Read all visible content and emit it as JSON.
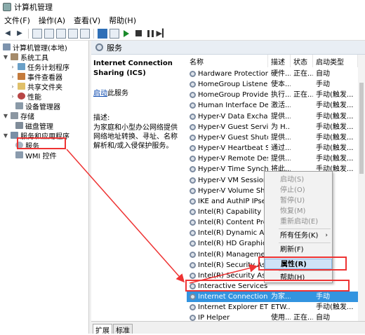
{
  "window": {
    "title": "计算机管理"
  },
  "menubar": {
    "items": [
      "文件(F)",
      "操作(A)",
      "查看(V)",
      "帮助(H)"
    ]
  },
  "tree": {
    "root": "计算机管理(本地)",
    "system_tools": "系统工具",
    "task_scheduler": "任务计划程序",
    "event_viewer": "事件查看器",
    "shared_folders": "共享文件夹",
    "performance": "性能",
    "device_manager": "设备管理器",
    "storage": "存储",
    "disk_management": "磁盘管理",
    "services_apps": "服务和应用程序",
    "services": "服务",
    "wmi": "WMI 控件"
  },
  "pane": {
    "title": "服务"
  },
  "description": {
    "service_name": "Internet Connection Sharing (ICS)",
    "start_link": "启动",
    "start_suffix": "此服务",
    "desc_label": "描述:",
    "desc_text": "为家庭和小型办公网络提供网络地址转换、寻址、名称解析和/或入侵保护服务。"
  },
  "columns": {
    "name": "名称",
    "desc": "描述",
    "status": "状态",
    "startup": "启动类型"
  },
  "services": [
    {
      "name": "Hardware Protection Ser...",
      "desc": "硬件...",
      "status": "正在...",
      "startup": "自动"
    },
    {
      "name": "HomeGroup Listener",
      "desc": "使本...",
      "status": "",
      "startup": "手动"
    },
    {
      "name": "HomeGroup Provider",
      "desc": "执行...",
      "status": "正在...",
      "startup": "手动(触发..."
    },
    {
      "name": "Human Interface Device ...",
      "desc": "激活...",
      "status": "",
      "startup": "手动(触发..."
    },
    {
      "name": "Hyper-V Data Exchange ...",
      "desc": "提供...",
      "status": "",
      "startup": "手动(触发..."
    },
    {
      "name": "Hyper-V Guest Service In...",
      "desc": "为 H...",
      "status": "",
      "startup": "手动(触发..."
    },
    {
      "name": "Hyper-V Guest Shutdown...",
      "desc": "提供...",
      "status": "",
      "startup": "手动(触发..."
    },
    {
      "name": "Hyper-V Heartbeat Service",
      "desc": "通过...",
      "status": "",
      "startup": "手动(触发..."
    },
    {
      "name": "Hyper-V Remote Deskto...",
      "desc": "提供...",
      "status": "",
      "startup": "手动(触发..."
    },
    {
      "name": "Hyper-V Time Synchroniz...",
      "desc": "将此...",
      "status": "",
      "startup": "手动(触发..."
    },
    {
      "name": "Hyper-V VM Session Ser...",
      "desc": "",
      "status": "",
      "startup": ""
    },
    {
      "name": "Hyper-V Volume Shadow...",
      "desc": "",
      "status": "",
      "startup": ""
    },
    {
      "name": "IKE and AuthIP IPsec Key...",
      "desc": "",
      "status": "",
      "startup": ""
    },
    {
      "name": "Intel(R) Capability Licensi...",
      "desc": "",
      "status": "",
      "startup": ""
    },
    {
      "name": "Intel(R) Content Protectio...",
      "desc": "",
      "status": "",
      "startup": ""
    },
    {
      "name": "Intel(R) Dynamic Applicat...",
      "desc": "",
      "status": "",
      "startup": ""
    },
    {
      "name": "Intel(R) HD Graphics Con...",
      "desc": "",
      "status": "",
      "startup": ""
    },
    {
      "name": "Intel(R) Management an...",
      "desc": "",
      "status": "",
      "startup": ""
    },
    {
      "name": "Intel(R) Security Assist",
      "desc": "",
      "status": "",
      "startup": ""
    },
    {
      "name": "Intel(R) Security Assist He...",
      "desc": "",
      "status": "",
      "startup": ""
    },
    {
      "name": "Interactive Services Dete...",
      "desc": "",
      "status": "",
      "startup": ""
    },
    {
      "name": "Internet Connection Shari...",
      "desc": "为家...",
      "status": "",
      "startup": "手动"
    },
    {
      "name": "Internet Explorer ETW Co...",
      "desc": "ETW...",
      "status": "",
      "startup": "手动(触发..."
    },
    {
      "name": "IP Helper",
      "desc": "使用...",
      "status": "正在...",
      "startup": "自动"
    }
  ],
  "context_menu": {
    "start": "启动(S)",
    "stop": "停止(O)",
    "pause": "暂停(U)",
    "resume": "恢复(M)",
    "restart": "重新启动(E)",
    "all_tasks": "所有任务(K)",
    "refresh": "刷新(F)",
    "properties": "属性(R)",
    "help": "帮助(H)",
    "submenu_arrow": "›"
  },
  "tabs": [
    "扩展",
    "标准"
  ],
  "colors": {
    "selection": "#3394e0",
    "annotation": "#e33333"
  }
}
